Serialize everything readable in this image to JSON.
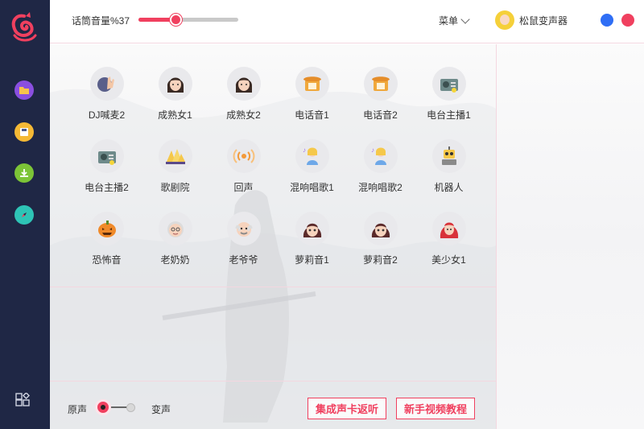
{
  "topbar": {
    "volume_label": "话筒音量%37",
    "volume_fraction": 0.37,
    "menu_label": "菜单",
    "user_name": "松鼠变声器"
  },
  "colors": {
    "accent": "#f0405f",
    "sidebar_bg": "#1f2745",
    "window_dot_blue": "#2f6ef5",
    "window_dot_red": "#f0405f"
  },
  "sidebar": {
    "items": [
      {
        "icon": "folder-icon",
        "color": "#8a4fe0"
      },
      {
        "icon": "save-icon",
        "color": "#f5b935"
      },
      {
        "icon": "download-icon",
        "color": "#7cc437"
      },
      {
        "icon": "compass-icon",
        "color": "#2ec4b6"
      }
    ],
    "bottom_icon": "grid-icon"
  },
  "effects": [
    {
      "label": "DJ喊麦2",
      "icon": "dj-hand-icon"
    },
    {
      "label": "成熟女1",
      "icon": "woman-face-icon"
    },
    {
      "label": "成熟女2",
      "icon": "woman-face-icon"
    },
    {
      "label": "电话音1",
      "icon": "telephone-icon"
    },
    {
      "label": "电话音2",
      "icon": "telephone-icon"
    },
    {
      "label": "电台主播1",
      "icon": "radio-icon"
    },
    {
      "label": "电台主播2",
      "icon": "radio-icon"
    },
    {
      "label": "歌剧院",
      "icon": "opera-house-icon"
    },
    {
      "label": "回声",
      "icon": "echo-icon"
    },
    {
      "label": "混响唱歌1",
      "icon": "singer-icon"
    },
    {
      "label": "混响唱歌2",
      "icon": "singer-icon"
    },
    {
      "label": "机器人",
      "icon": "robot-icon"
    },
    {
      "label": "恐怖音",
      "icon": "pumpkin-icon"
    },
    {
      "label": "老奶奶",
      "icon": "grandma-icon"
    },
    {
      "label": "老爷爷",
      "icon": "grandpa-icon"
    },
    {
      "label": "萝莉音1",
      "icon": "girl-face-icon"
    },
    {
      "label": "萝莉音2",
      "icon": "girl-face-icon"
    },
    {
      "label": "美少女1",
      "icon": "red-hair-girl-icon"
    }
  ],
  "bottom": {
    "original_label": "原声",
    "changed_label": "变声",
    "soundcard_button": "集成声卡返听",
    "tutorial_button": "新手视频教程"
  }
}
